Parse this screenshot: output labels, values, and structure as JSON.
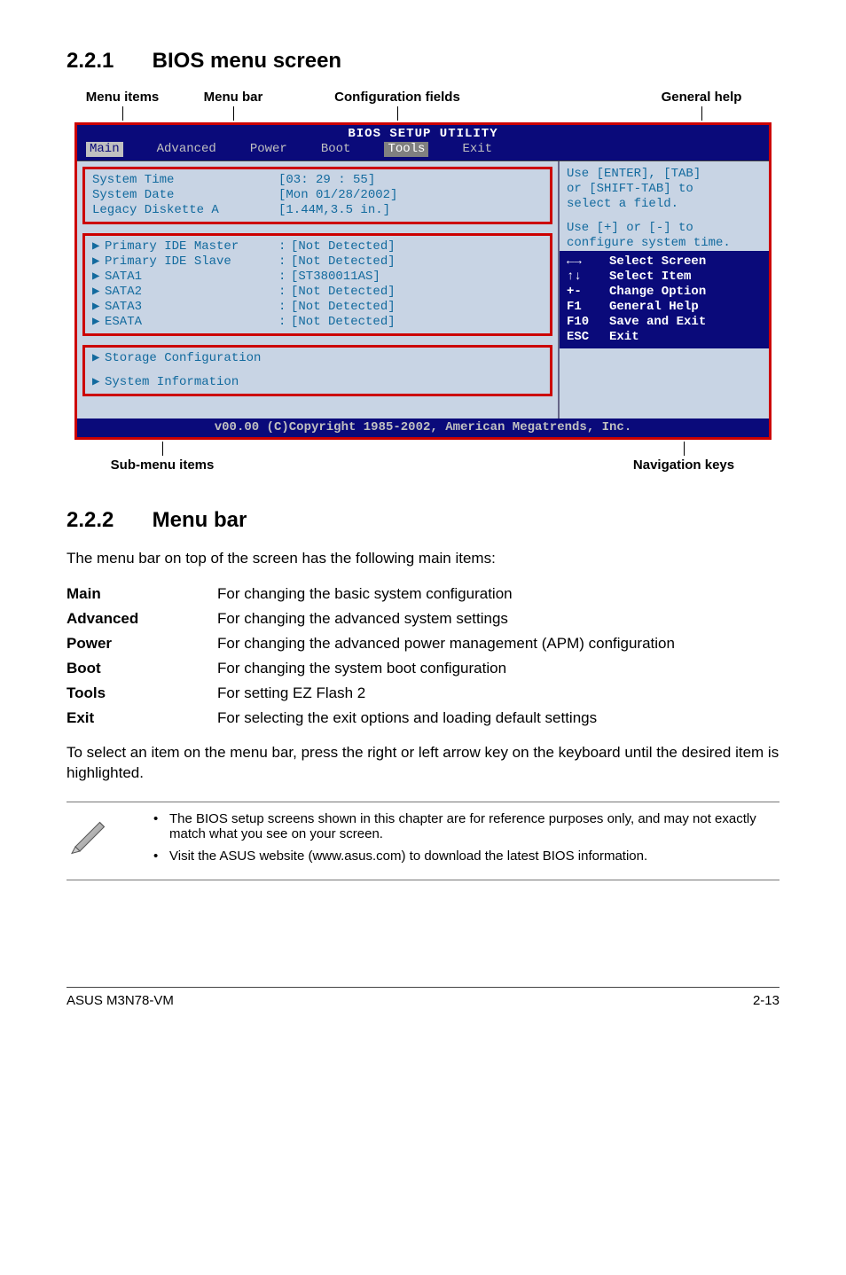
{
  "h1": {
    "num": "2.2.1",
    "title": "BIOS menu screen"
  },
  "callouts_top": {
    "menu_items": "Menu items",
    "menu_bar": "Menu bar",
    "config_fields": "Configuration fields",
    "general_help": "General help"
  },
  "bios": {
    "title": "BIOS SETUP UTILITY",
    "menus": [
      "Main",
      "Advanced",
      "Power",
      "Boot",
      "Tools",
      "Exit"
    ],
    "block1": {
      "r1": {
        "label": "System Time",
        "value": "[03: 29 : 55]"
      },
      "r2": {
        "label": "System Date",
        "value": "[Mon 01/28/2002]"
      },
      "r3": {
        "label": "Legacy Diskette A",
        "value": "[1.44M,3.5 in.]"
      }
    },
    "block2": {
      "r1": {
        "label": "Primary IDE Master",
        "value": "[Not Detected]"
      },
      "r2": {
        "label": "Primary IDE Slave",
        "value": "[Not Detected]"
      },
      "r3": {
        "label": "SATA1",
        "value": "[ST380011AS]"
      },
      "r4": {
        "label": "SATA2",
        "value": "[Not Detected]"
      },
      "r5": {
        "label": "SATA3",
        "value": "[Not Detected]"
      },
      "r6": {
        "label": "ESATA",
        "value": "[Not Detected]"
      }
    },
    "block3": {
      "r1": "Storage Configuration",
      "r2": "System Information"
    },
    "help_top": {
      "l1": "Use [ENTER], [TAB]",
      "l2": "or [SHIFT-TAB] to",
      "l3": "select a field.",
      "l4": "Use [+] or [-] to",
      "l5": "configure system time."
    },
    "help_keys": {
      "k1": {
        "key": "←→",
        "act": "Select Screen"
      },
      "k2": {
        "key": "↑↓",
        "act": "Select Item"
      },
      "k3": {
        "key": "+-",
        "act": "Change Option"
      },
      "k4": {
        "key": "F1",
        "act": "General Help"
      },
      "k5": {
        "key": "F10",
        "act": "Save and Exit"
      },
      "k6": {
        "key": "ESC",
        "act": "Exit"
      }
    },
    "footer": "v00.00 (C)Copyright 1985-2002, American Megatrends, Inc."
  },
  "callouts_bottom": {
    "submenu": "Sub-menu items",
    "navkeys": "Navigation keys"
  },
  "h2": {
    "num": "2.2.2",
    "title": "Menu bar"
  },
  "p1": "The menu bar on top of the screen has the following main items:",
  "deftable": {
    "main": {
      "t": "Main",
      "d": "For changing the basic system configuration"
    },
    "adv": {
      "t": "Advanced",
      "d": "For changing the advanced system settings"
    },
    "power": {
      "t": "Power",
      "d": "For changing the advanced power management (APM) configuration"
    },
    "boot": {
      "t": "Boot",
      "d": "For changing the system boot configuration"
    },
    "tools": {
      "t": "Tools",
      "d": "For setting EZ Flash 2"
    },
    "exit": {
      "t": "Exit",
      "d": "For selecting the exit options and loading default settings"
    }
  },
  "p2": "To select an item on the menu bar, press the right or left arrow key on the keyboard until the desired item is highlighted.",
  "notes": {
    "n1": "The BIOS setup screens shown in this chapter are for reference purposes only, and may not exactly match what you see on your screen.",
    "n2": "Visit the ASUS website (www.asus.com) to download the latest BIOS information."
  },
  "footer": {
    "left": "ASUS M3N78-VM",
    "right": "2-13"
  }
}
